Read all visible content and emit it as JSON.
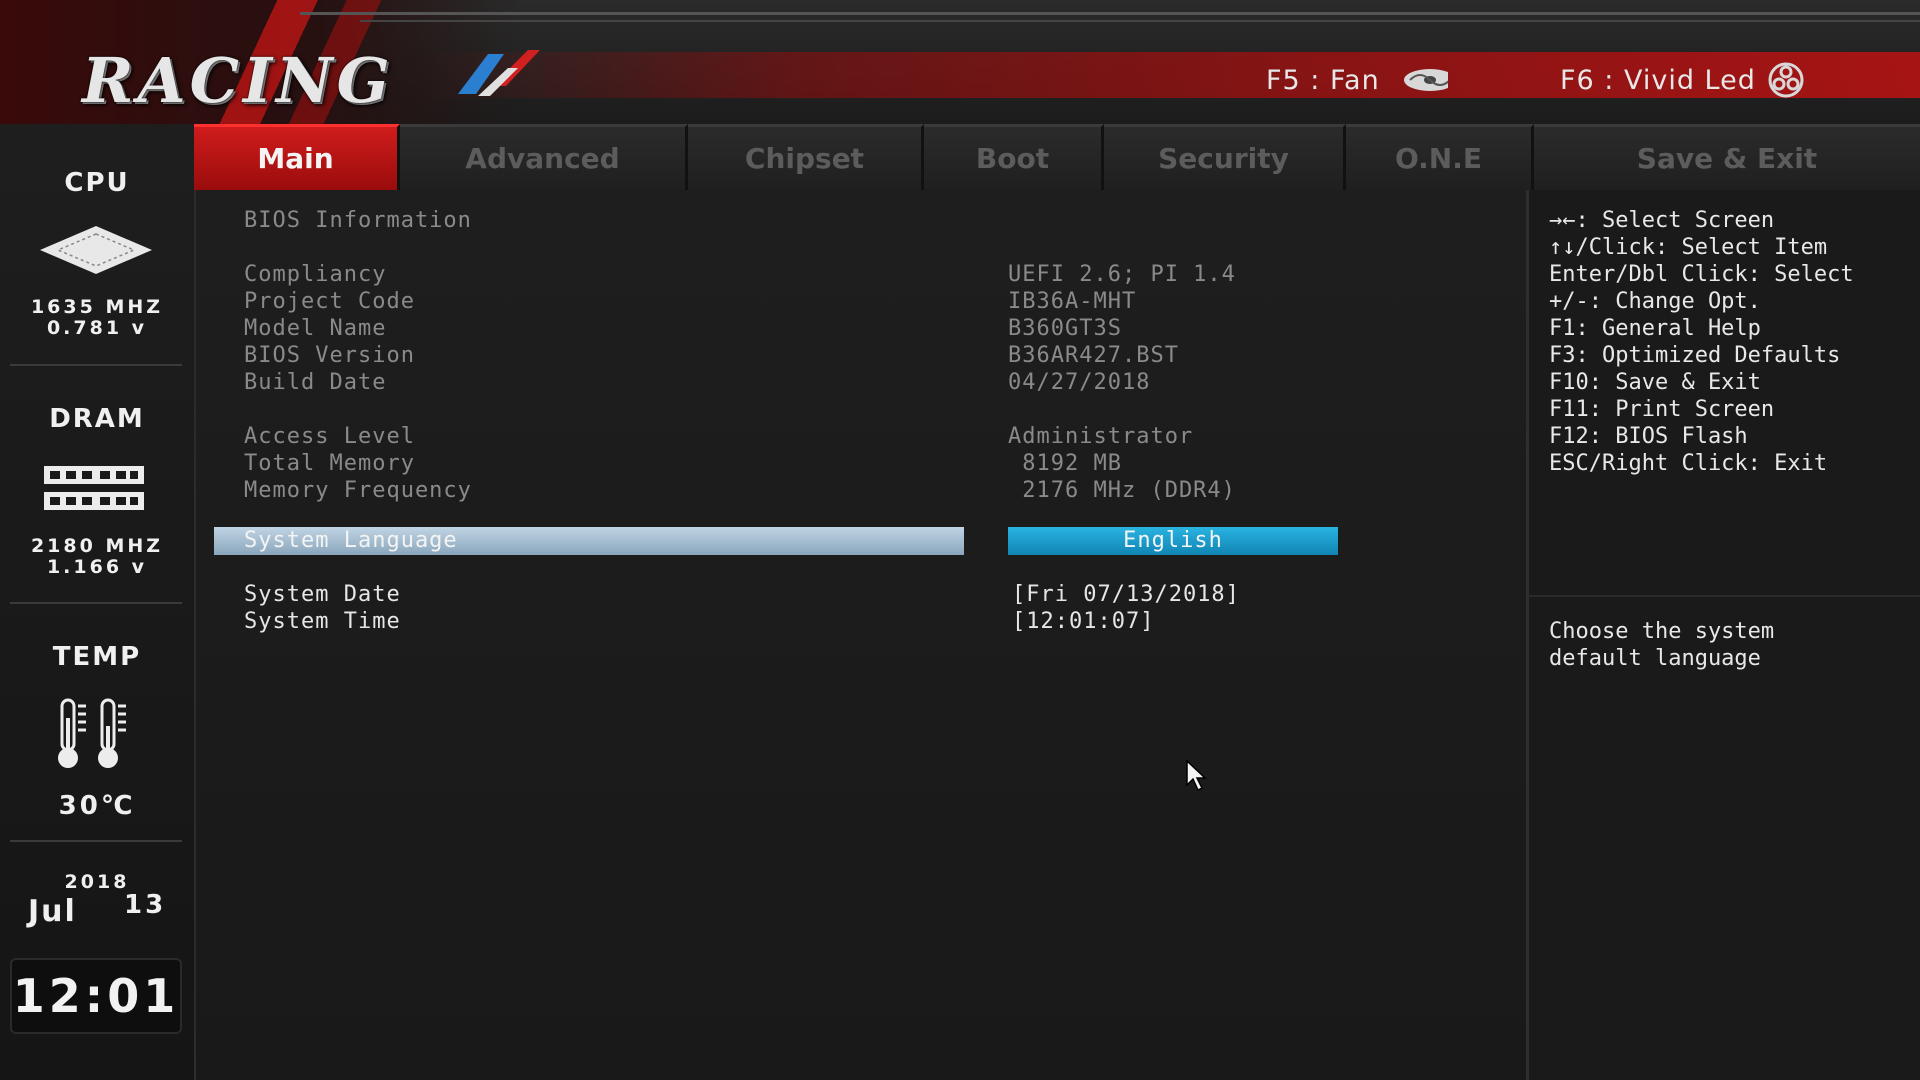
{
  "brand": {
    "logo": "RACING"
  },
  "hotkeys": [
    {
      "label": "F5 : Fan"
    },
    {
      "label": "F6 : Vivid Led"
    }
  ],
  "sidebar": {
    "cpu": {
      "title": "CPU",
      "freq": "1635 MHZ",
      "volt": "0.781 v"
    },
    "dram": {
      "title": "DRAM",
      "freq": "2180 MHZ",
      "volt": "1.166 v"
    },
    "temp": {
      "title": "TEMP",
      "value": "30℃"
    },
    "date": {
      "year": "2018",
      "month": "Jul",
      "day": "13"
    },
    "clock": "12:01"
  },
  "tabs": [
    {
      "label": "Main",
      "active": true
    },
    {
      "label": "Advanced"
    },
    {
      "label": "Chipset"
    },
    {
      "label": "Boot"
    },
    {
      "label": "Security"
    },
    {
      "label": "O.N.E"
    },
    {
      "label": "Save & Exit"
    }
  ],
  "main": {
    "section_title": "BIOS Information",
    "info": [
      {
        "label": "Compliancy",
        "value": "UEFI 2.6; PI 1.4"
      },
      {
        "label": "Project Code",
        "value": "IB36A-MHT"
      },
      {
        "label": "Model Name",
        "value": "B360GT3S"
      },
      {
        "label": "BIOS Version",
        "value": "B36AR427.BST"
      },
      {
        "label": "Build Date",
        "value": "04/27/2018"
      }
    ],
    "info2": [
      {
        "label": "Access Level",
        "value": "Administrator"
      },
      {
        "label": "Total Memory",
        "value": " 8192 MB"
      },
      {
        "label": "Memory Frequency",
        "value": " 2176 MHz (DDR4)"
      }
    ],
    "language": {
      "label": "System Language",
      "value": "English"
    },
    "date": {
      "label": "System Date",
      "value": "[Fri 07/13/2018]"
    },
    "time": {
      "label": "System Time",
      "value": "[12:01:07]"
    }
  },
  "help": {
    "keys": [
      "→←: Select Screen",
      "↑↓/Click: Select Item",
      "Enter/Dbl Click: Select",
      "+/-: Change Opt.",
      "F1: General Help",
      "F3: Optimized Defaults",
      "F10: Save & Exit",
      "F11: Print Screen",
      "F12: BIOS Flash",
      "ESC/Right Click: Exit"
    ],
    "description": [
      "Choose the system",
      "default language"
    ]
  },
  "colors": {
    "accent_red": "#c41616",
    "selection_blue": "#1a9fd0",
    "selection_bar": "#a8bfd2"
  }
}
